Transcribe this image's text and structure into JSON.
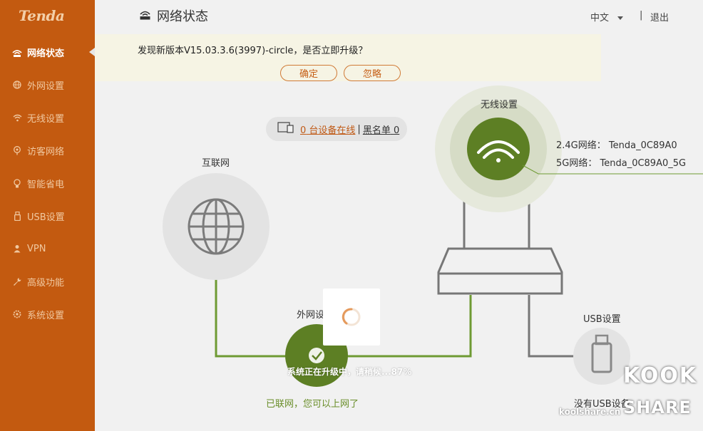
{
  "brand": {
    "logo_text": "Tenda"
  },
  "sidebar": {
    "items": [
      {
        "label": "网络状态",
        "icon": "network-status-icon",
        "active": true
      },
      {
        "label": "外网设置",
        "icon": "globe-icon",
        "active": false
      },
      {
        "label": "无线设置",
        "icon": "wifi-icon",
        "active": false
      },
      {
        "label": "访客网络",
        "icon": "guest-icon",
        "active": false
      },
      {
        "label": "智能省电",
        "icon": "bulb-icon",
        "active": false
      },
      {
        "label": "USB设置",
        "icon": "usb-icon",
        "active": false
      },
      {
        "label": "VPN",
        "icon": "vpn-icon",
        "active": false
      },
      {
        "label": "高级功能",
        "icon": "wrench-icon",
        "active": false
      },
      {
        "label": "系统设置",
        "icon": "gear-icon",
        "active": false
      }
    ]
  },
  "header": {
    "title": "网络状态",
    "language": "中文",
    "separator": "|",
    "logout": "退出"
  },
  "upgrade_banner": {
    "message": "发现新版本V15.03.3.6(3997)-circle，是否立即升级？",
    "confirm_label": "确定",
    "ignore_label": "忽略"
  },
  "devices": {
    "online_count": "0",
    "online_suffix": " 台设备在线",
    "divider": "|",
    "blacklist_label": "黑名单",
    "blacklist_count": "0"
  },
  "diagram": {
    "internet_label": "互联网",
    "wan_label": "外网设",
    "wireless_label": "无线设置",
    "wifi_24_label": "2.4G网络：",
    "wifi_24_ssid": "Tenda_0C89A0",
    "wifi_5_label": "5G网络：",
    "wifi_5_ssid": "Tenda_0C89A0_5G",
    "usb_label": "USB设置",
    "usb_status": "没有USB设备",
    "connected_message": "已联网，您可以上网了"
  },
  "upgrade_progress": {
    "message": "系统正在升级中，请稍候...87%",
    "percent": 87
  },
  "watermark": {
    "site": "koolshare.cn",
    "line1": "KOOK",
    "line2": "SHARE"
  },
  "colors": {
    "sidebar": "#c35a10",
    "accent_orange": "#c65f16",
    "wan_green": "#6a8e2a",
    "wifi_green": "#5d7f24"
  }
}
